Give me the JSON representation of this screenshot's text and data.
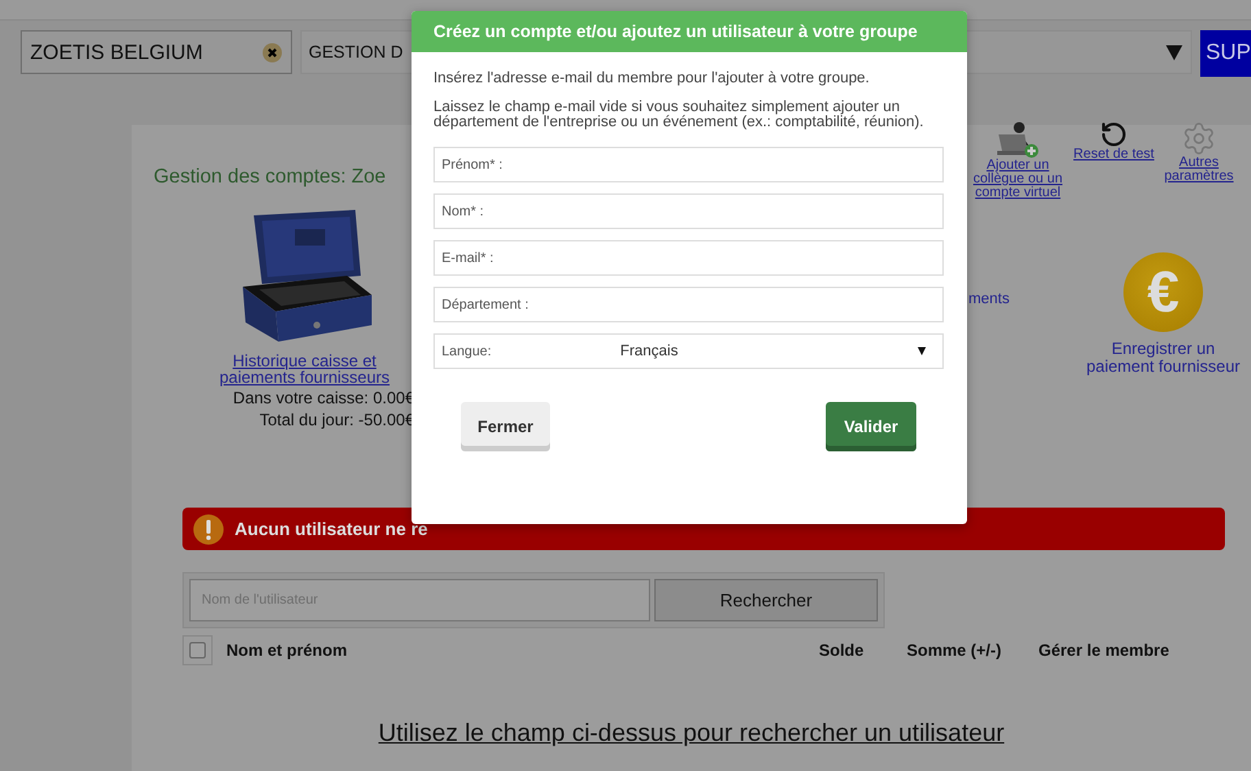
{
  "toolbar": {
    "company": "ZOETIS BELGIUM",
    "view": "GESTION D",
    "button": "SUP"
  },
  "page_title": "Gestion des comptes: Zoe",
  "cashbox": {
    "link": "Historique caisse et paiements fournisseurs",
    "balance": "Dans votre caisse: 0.00€",
    "total": "Total du jour: -50.00€"
  },
  "actions": [
    {
      "kind": "add-user",
      "label": "Ajouter un collègue ou un compte virtuel"
    },
    {
      "kind": "reset",
      "label": "Reset de test"
    },
    {
      "kind": "settings",
      "label": "Autres paramètres"
    }
  ],
  "payments_fragment": "ments",
  "supplier_payment": {
    "symbol": "€",
    "label": "Enregistrer un paiement fournisseur"
  },
  "alert": "Aucun utilisateur ne re",
  "search": {
    "placeholder": "Nom de l'utilisateur",
    "button": "Rechercher"
  },
  "table": {
    "select_all_checked": false,
    "columns": [
      "Nom et prénom",
      "Solde",
      "Somme (+/-)",
      "Gérer le membre"
    ]
  },
  "hint": "Utilisez le champ ci-dessus pour rechercher un utilisateur",
  "modal": {
    "title": "Créez un compte et/ou ajoutez un utilisateur à votre groupe",
    "intro": "Insérez l'adresse e-mail du membre pour l'ajouter à votre groupe.",
    "note": "Laissez le champ e-mail vide si vous souhaitez simplement ajouter un département de l'entreprise ou un événement (ex.: comptabilité, réunion).",
    "fields": [
      {
        "kind": "text",
        "placeholder": "Prénom* :"
      },
      {
        "kind": "text",
        "placeholder": "Nom* :"
      },
      {
        "kind": "text",
        "placeholder": "E-mail* :"
      },
      {
        "kind": "text",
        "placeholder": "Département :"
      },
      {
        "kind": "select",
        "label": "Langue:",
        "value": "Français"
      }
    ],
    "buttons": [
      {
        "kind": "secondary",
        "label": "Fermer"
      },
      {
        "kind": "primary",
        "label": "Valider"
      }
    ]
  }
}
